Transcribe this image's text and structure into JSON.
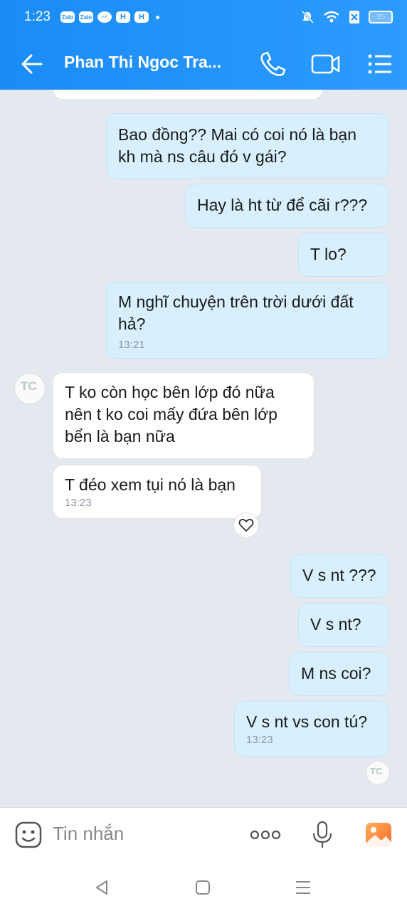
{
  "status_bar": {
    "time": "1:23",
    "notif_icons": [
      "Zalo",
      "Zalo",
      "messenger-icon",
      "H",
      "H"
    ],
    "battery": "35"
  },
  "header": {
    "title": "Phan Thi Ngoc Tra...",
    "icons": [
      "back-arrow-icon",
      "phone-icon",
      "video-call-icon",
      "menu-icon"
    ]
  },
  "messages": [
    {
      "from": "me",
      "lines": [
        "Bao đồng?? Mai có coi nó là bạn",
        "kh mà ns câu đó v gái?"
      ],
      "time": ""
    },
    {
      "from": "me",
      "lines": [
        "Hay là ht từ để cãi r???"
      ],
      "time": ""
    },
    {
      "from": "me",
      "lines": [
        "T lo?"
      ],
      "time": ""
    },
    {
      "from": "me",
      "lines": [
        "M nghĩ chuyện trên trời dưới đất",
        "hả?"
      ],
      "time": "13:21"
    },
    {
      "from": "them",
      "lines": [
        "T ko còn học bên lớp đó nữa",
        "nên t ko coi mấy đứa bên  lớp",
        "bển là bạn nữa"
      ],
      "time": ""
    },
    {
      "from": "them",
      "lines": [
        "T đéo xem tụi nó là bạn"
      ],
      "time": "13:23"
    },
    {
      "from": "me",
      "lines": [
        "V s nt ???"
      ],
      "time": ""
    },
    {
      "from": "me",
      "lines": [
        "V s nt?"
      ],
      "time": ""
    },
    {
      "from": "me",
      "lines": [
        "M ns coi?"
      ],
      "time": ""
    },
    {
      "from": "me",
      "lines": [
        "V s nt vs con tú?"
      ],
      "time": "13:23"
    }
  ],
  "avatar_text": "TC",
  "input_bar": {
    "placeholder": "Tin nhắn",
    "icons": [
      "sticker-icon",
      "more-icon",
      "microphone-icon",
      "image-icon"
    ]
  },
  "system_nav": [
    "back-icon",
    "home-icon",
    "recents-icon"
  ],
  "colors": {
    "header": "#1a8cf5",
    "my_bubble": "#d8effd",
    "their_bubble": "#ffffff",
    "chat_bg": "#e4e8ef"
  }
}
